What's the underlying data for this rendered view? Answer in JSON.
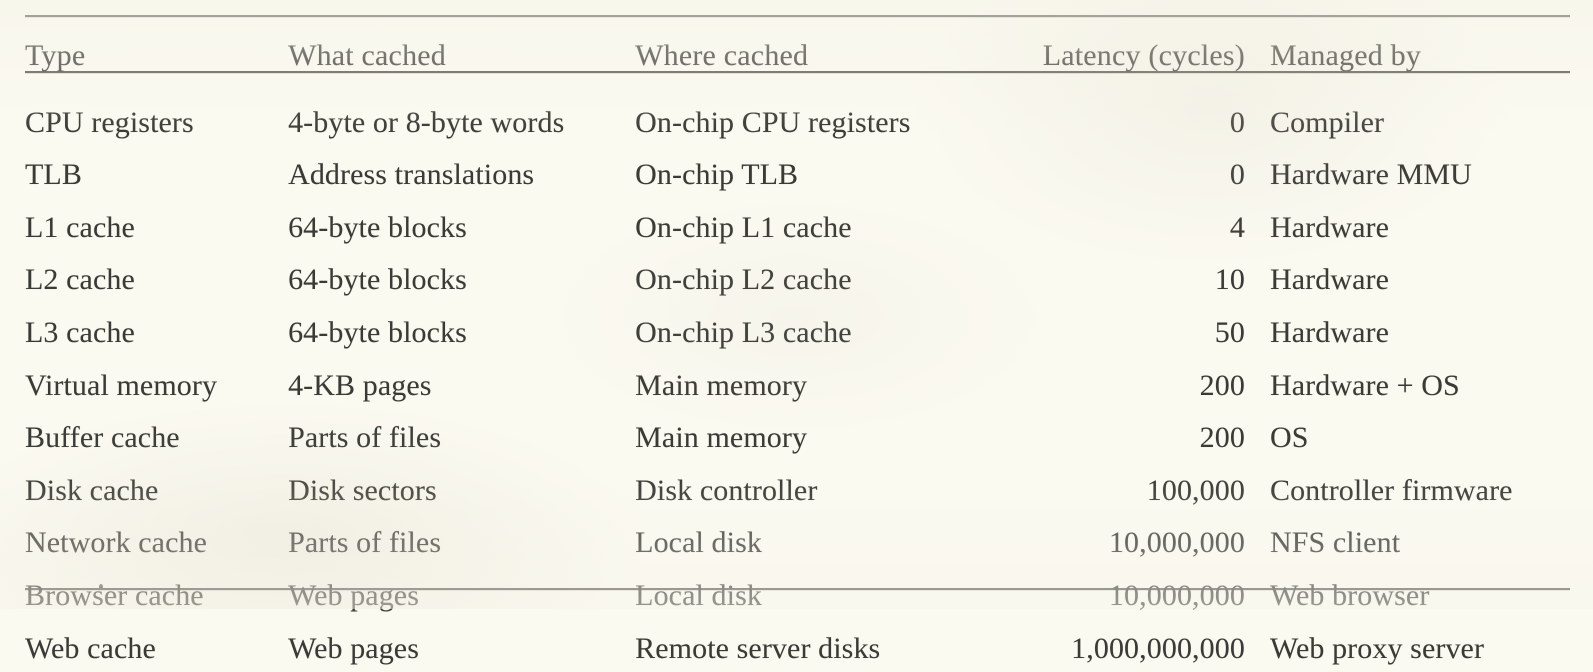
{
  "table": {
    "columns": [
      {
        "key": "type",
        "label": "Type"
      },
      {
        "key": "what",
        "label": "What cached"
      },
      {
        "key": "where",
        "label": "Where cached"
      },
      {
        "key": "latency",
        "label": "Latency (cycles)"
      },
      {
        "key": "managed",
        "label": "Managed by"
      }
    ],
    "rows": [
      {
        "type": "CPU registers",
        "what": "4-byte or 8-byte words",
        "where": "On-chip CPU registers",
        "latency": "0",
        "managed": "Compiler"
      },
      {
        "type": "TLB",
        "what": "Address translations",
        "where": "On-chip TLB",
        "latency": "0",
        "managed": "Hardware MMU"
      },
      {
        "type": "L1 cache",
        "what": "64-byte blocks",
        "where": "On-chip L1 cache",
        "latency": "4",
        "managed": "Hardware"
      },
      {
        "type": "L2 cache",
        "what": "64-byte blocks",
        "where": "On-chip L2 cache",
        "latency": "10",
        "managed": "Hardware"
      },
      {
        "type": "L3 cache",
        "what": "64-byte blocks",
        "where": "On-chip L3 cache",
        "latency": "50",
        "managed": "Hardware"
      },
      {
        "type": "Virtual memory",
        "what": "4-KB pages",
        "where": "Main memory",
        "latency": "200",
        "managed": "Hardware + OS"
      },
      {
        "type": "Buffer cache",
        "what": "Parts of files",
        "where": "Main memory",
        "latency": "200",
        "managed": "OS"
      },
      {
        "type": "Disk cache",
        "what": "Disk sectors",
        "where": "Disk controller",
        "latency": "100,000",
        "managed": "Controller firmware"
      },
      {
        "type": "Network cache",
        "what": "Parts of files",
        "where": "Local disk",
        "latency": "10,000,000",
        "managed": "NFS client"
      },
      {
        "type": "Browser cache",
        "what": "Web pages",
        "where": "Local disk",
        "latency": "10,000,000",
        "managed": "Web browser"
      },
      {
        "type": "Web cache",
        "what": "Web pages",
        "where": "Remote server disks",
        "latency": "1,000,000,000",
        "managed": "Web proxy server"
      }
    ]
  },
  "style": {
    "page_background": "#fbfaf1",
    "text_color": "#3a3a36",
    "rule_color": "#55544e"
  }
}
